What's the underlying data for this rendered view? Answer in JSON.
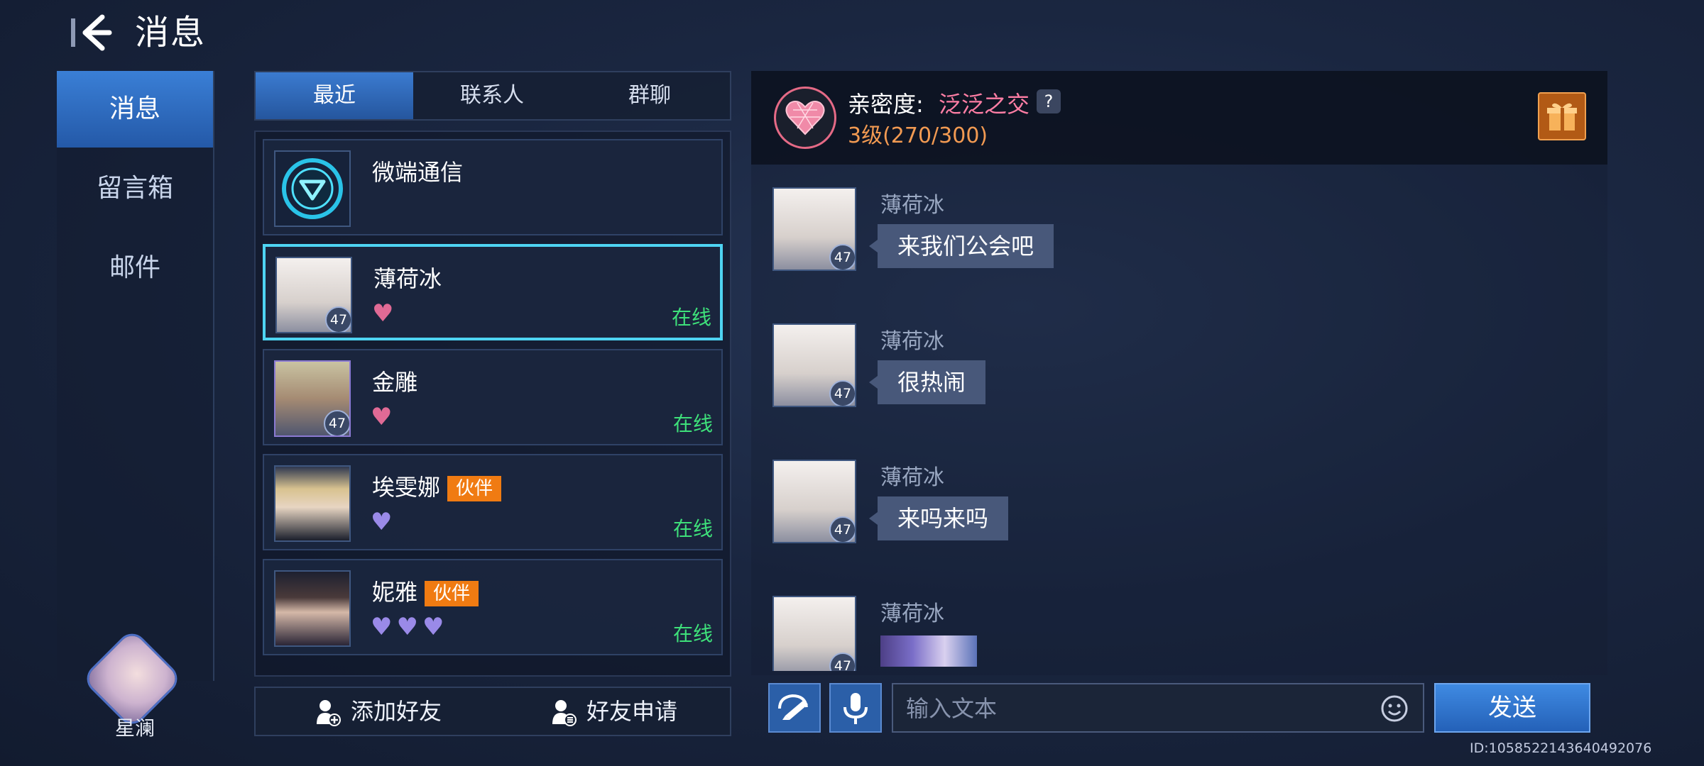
{
  "header": {
    "title": "消息"
  },
  "nav": {
    "items": [
      {
        "label": "消息",
        "active": true
      },
      {
        "label": "留言箱",
        "active": false
      },
      {
        "label": "邮件",
        "active": false
      }
    ],
    "user_name": "星澜"
  },
  "tabs": [
    {
      "label": "最近",
      "active": true
    },
    {
      "label": "联系人",
      "active": false
    },
    {
      "label": "群聊",
      "active": false
    }
  ],
  "contacts": [
    {
      "name": "微端通信",
      "badge": "",
      "level": "",
      "status": "",
      "hearts": ""
    },
    {
      "name": "薄荷冰",
      "badge": "",
      "level": "47",
      "status": "在线",
      "hearts": "♥",
      "selected": true
    },
    {
      "name": "金雕",
      "badge": "",
      "level": "47",
      "status": "在线",
      "hearts": "♥"
    },
    {
      "name": "埃雯娜",
      "badge": "伙伴",
      "level": "",
      "status": "在线",
      "hearts": "♥"
    },
    {
      "name": "妮雅",
      "badge": "伙伴",
      "level": "",
      "status": "在线",
      "hearts": "♥♥♥"
    }
  ],
  "list_actions": {
    "add_friend": "添加好友",
    "friend_requests": "好友申请"
  },
  "intimacy": {
    "label": "亲密度:",
    "value": "泛泛之交",
    "help": "?",
    "level": "3级(270/300)"
  },
  "messages": [
    {
      "sender": "薄荷冰",
      "level": "47",
      "text": "来我们公会吧"
    },
    {
      "sender": "薄荷冰",
      "level": "47",
      "text": "很热闹"
    },
    {
      "sender": "薄荷冰",
      "level": "47",
      "text": "来吗来吗"
    },
    {
      "sender": "薄荷冰",
      "level": "47",
      "text": ""
    }
  ],
  "composer": {
    "placeholder": "输入文本",
    "send_label": "发送"
  },
  "footer": {
    "uid": "ID:1058522143640492076"
  },
  "colors": {
    "accent": "#3b7bd0",
    "online": "#3ee07a",
    "partner_badge": "#f07b12",
    "intimacy_value": "#ff7ea5",
    "intimacy_level": "#f29a52"
  }
}
